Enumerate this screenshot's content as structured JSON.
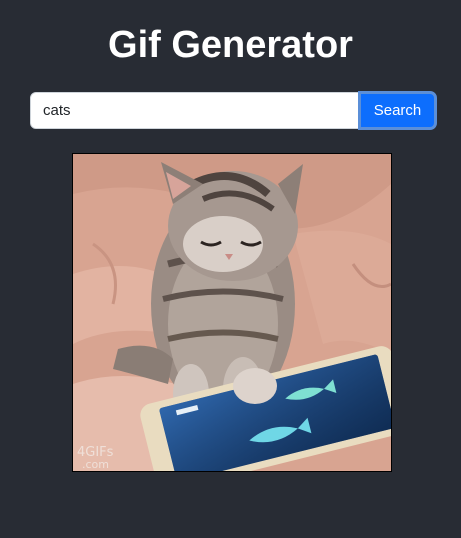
{
  "header": {
    "title": "Gif Generator"
  },
  "search": {
    "value": "cats",
    "placeholder": "",
    "button_label": "Search"
  },
  "gif": {
    "subject": "kitten-playing-tablet-game",
    "watermark_line1": "4GIFs",
    "watermark_line2": ".com"
  },
  "colors": {
    "background": "#282c34",
    "accent": "#0d6efd",
    "title": "#ffffff"
  }
}
